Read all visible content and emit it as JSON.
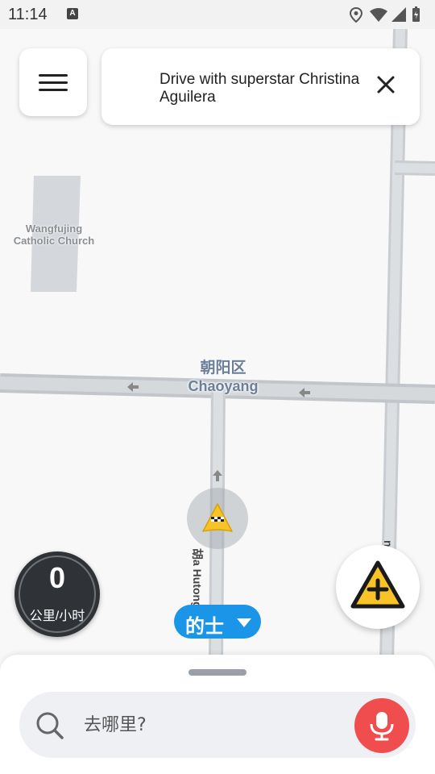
{
  "status_bar": {
    "time": "11:14",
    "notification_icon": "A"
  },
  "promo_banner": {
    "text": "Drive with superstar Christina Aguilera"
  },
  "map": {
    "poi_label": "Wangfujing Catholic Church",
    "district_zh": "朝阳区",
    "district_en": "Chaoyang",
    "street_1": "胡a Hutong",
    "street_2": "ng a"
  },
  "speedometer": {
    "value": "0",
    "unit": "公里/小时"
  },
  "mode_selector": {
    "label": "的士"
  },
  "search": {
    "placeholder": "去哪里?"
  },
  "colors": {
    "accent_blue": "#1a95e8",
    "mic_red": "#f04e4e",
    "hazard_yellow": "#f7c326"
  },
  "icons": [
    "menu-icon",
    "close-icon",
    "taxi-marker-icon",
    "report-hazard-icon",
    "search-icon",
    "microphone-icon",
    "location-icon",
    "wifi-icon",
    "signal-icon",
    "battery-icon"
  ]
}
